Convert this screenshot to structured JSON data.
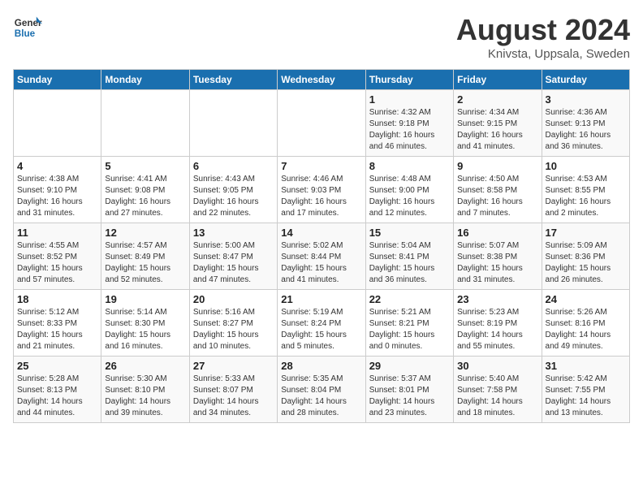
{
  "header": {
    "logo_general": "General",
    "logo_blue": "Blue",
    "month_year": "August 2024",
    "location": "Knivsta, Uppsala, Sweden"
  },
  "days_of_week": [
    "Sunday",
    "Monday",
    "Tuesday",
    "Wednesday",
    "Thursday",
    "Friday",
    "Saturday"
  ],
  "weeks": [
    [
      {
        "day": "",
        "info": ""
      },
      {
        "day": "",
        "info": ""
      },
      {
        "day": "",
        "info": ""
      },
      {
        "day": "",
        "info": ""
      },
      {
        "day": "1",
        "info": "Sunrise: 4:32 AM\nSunset: 9:18 PM\nDaylight: 16 hours\nand 46 minutes."
      },
      {
        "day": "2",
        "info": "Sunrise: 4:34 AM\nSunset: 9:15 PM\nDaylight: 16 hours\nand 41 minutes."
      },
      {
        "day": "3",
        "info": "Sunrise: 4:36 AM\nSunset: 9:13 PM\nDaylight: 16 hours\nand 36 minutes."
      }
    ],
    [
      {
        "day": "4",
        "info": "Sunrise: 4:38 AM\nSunset: 9:10 PM\nDaylight: 16 hours\nand 31 minutes."
      },
      {
        "day": "5",
        "info": "Sunrise: 4:41 AM\nSunset: 9:08 PM\nDaylight: 16 hours\nand 27 minutes."
      },
      {
        "day": "6",
        "info": "Sunrise: 4:43 AM\nSunset: 9:05 PM\nDaylight: 16 hours\nand 22 minutes."
      },
      {
        "day": "7",
        "info": "Sunrise: 4:46 AM\nSunset: 9:03 PM\nDaylight: 16 hours\nand 17 minutes."
      },
      {
        "day": "8",
        "info": "Sunrise: 4:48 AM\nSunset: 9:00 PM\nDaylight: 16 hours\nand 12 minutes."
      },
      {
        "day": "9",
        "info": "Sunrise: 4:50 AM\nSunset: 8:58 PM\nDaylight: 16 hours\nand 7 minutes."
      },
      {
        "day": "10",
        "info": "Sunrise: 4:53 AM\nSunset: 8:55 PM\nDaylight: 16 hours\nand 2 minutes."
      }
    ],
    [
      {
        "day": "11",
        "info": "Sunrise: 4:55 AM\nSunset: 8:52 PM\nDaylight: 15 hours\nand 57 minutes."
      },
      {
        "day": "12",
        "info": "Sunrise: 4:57 AM\nSunset: 8:49 PM\nDaylight: 15 hours\nand 52 minutes."
      },
      {
        "day": "13",
        "info": "Sunrise: 5:00 AM\nSunset: 8:47 PM\nDaylight: 15 hours\nand 47 minutes."
      },
      {
        "day": "14",
        "info": "Sunrise: 5:02 AM\nSunset: 8:44 PM\nDaylight: 15 hours\nand 41 minutes."
      },
      {
        "day": "15",
        "info": "Sunrise: 5:04 AM\nSunset: 8:41 PM\nDaylight: 15 hours\nand 36 minutes."
      },
      {
        "day": "16",
        "info": "Sunrise: 5:07 AM\nSunset: 8:38 PM\nDaylight: 15 hours\nand 31 minutes."
      },
      {
        "day": "17",
        "info": "Sunrise: 5:09 AM\nSunset: 8:36 PM\nDaylight: 15 hours\nand 26 minutes."
      }
    ],
    [
      {
        "day": "18",
        "info": "Sunrise: 5:12 AM\nSunset: 8:33 PM\nDaylight: 15 hours\nand 21 minutes."
      },
      {
        "day": "19",
        "info": "Sunrise: 5:14 AM\nSunset: 8:30 PM\nDaylight: 15 hours\nand 16 minutes."
      },
      {
        "day": "20",
        "info": "Sunrise: 5:16 AM\nSunset: 8:27 PM\nDaylight: 15 hours\nand 10 minutes."
      },
      {
        "day": "21",
        "info": "Sunrise: 5:19 AM\nSunset: 8:24 PM\nDaylight: 15 hours\nand 5 minutes."
      },
      {
        "day": "22",
        "info": "Sunrise: 5:21 AM\nSunset: 8:21 PM\nDaylight: 15 hours\nand 0 minutes."
      },
      {
        "day": "23",
        "info": "Sunrise: 5:23 AM\nSunset: 8:19 PM\nDaylight: 14 hours\nand 55 minutes."
      },
      {
        "day": "24",
        "info": "Sunrise: 5:26 AM\nSunset: 8:16 PM\nDaylight: 14 hours\nand 49 minutes."
      }
    ],
    [
      {
        "day": "25",
        "info": "Sunrise: 5:28 AM\nSunset: 8:13 PM\nDaylight: 14 hours\nand 44 minutes."
      },
      {
        "day": "26",
        "info": "Sunrise: 5:30 AM\nSunset: 8:10 PM\nDaylight: 14 hours\nand 39 minutes."
      },
      {
        "day": "27",
        "info": "Sunrise: 5:33 AM\nSunset: 8:07 PM\nDaylight: 14 hours\nand 34 minutes."
      },
      {
        "day": "28",
        "info": "Sunrise: 5:35 AM\nSunset: 8:04 PM\nDaylight: 14 hours\nand 28 minutes."
      },
      {
        "day": "29",
        "info": "Sunrise: 5:37 AM\nSunset: 8:01 PM\nDaylight: 14 hours\nand 23 minutes."
      },
      {
        "day": "30",
        "info": "Sunrise: 5:40 AM\nSunset: 7:58 PM\nDaylight: 14 hours\nand 18 minutes."
      },
      {
        "day": "31",
        "info": "Sunrise: 5:42 AM\nSunset: 7:55 PM\nDaylight: 14 hours\nand 13 minutes."
      }
    ]
  ]
}
